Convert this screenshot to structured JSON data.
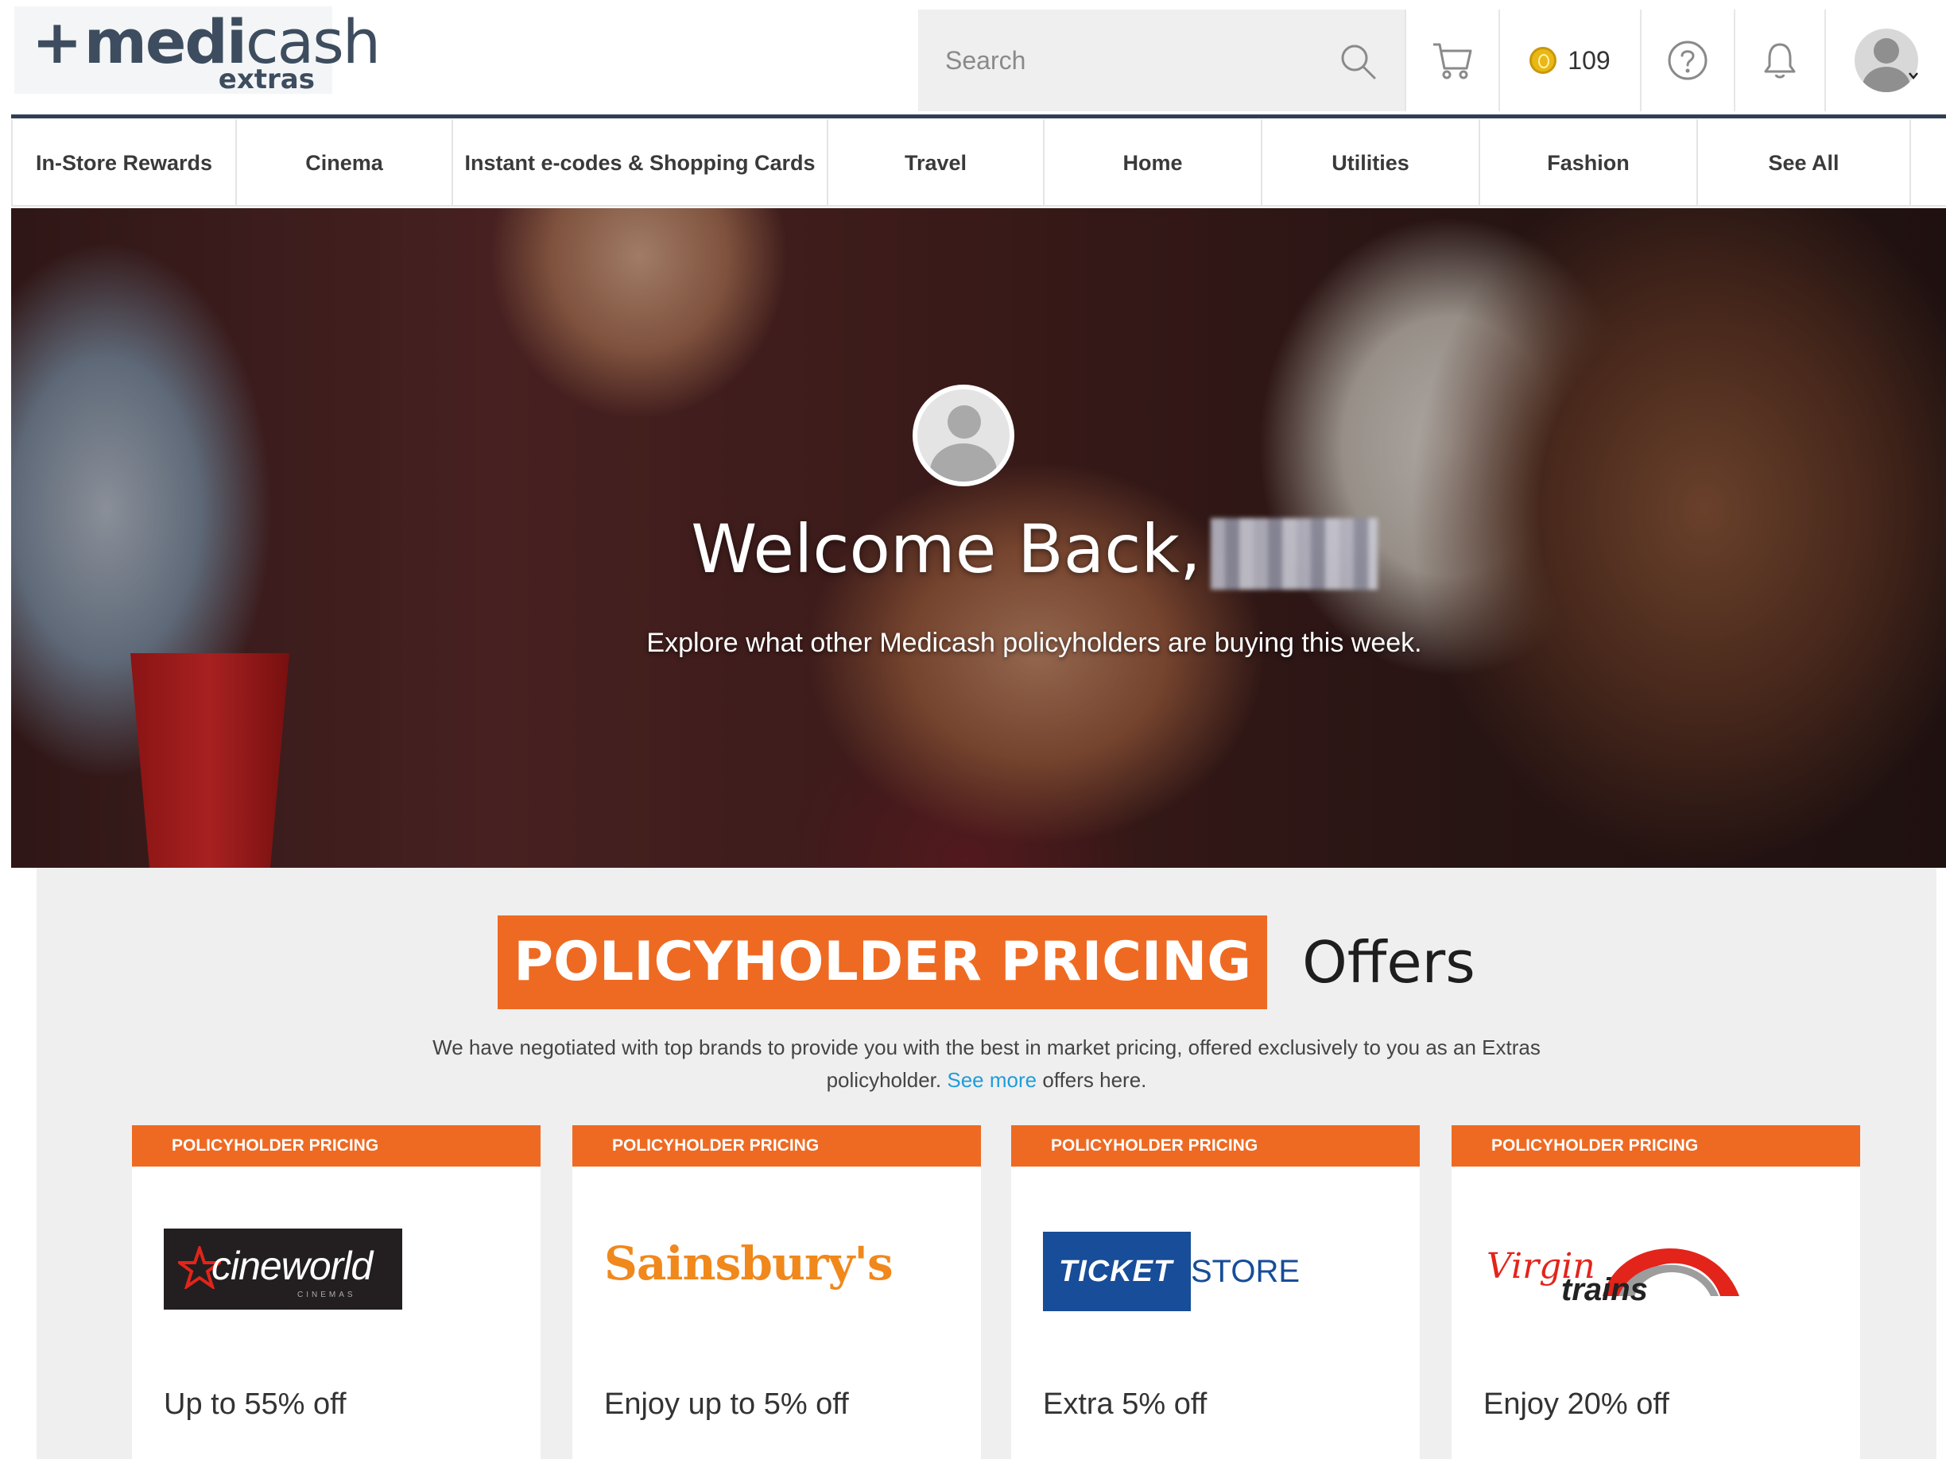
{
  "logo": {
    "main_prefix": "+",
    "main_medi": "medi",
    "main_cash": "cash",
    "sub": "extras"
  },
  "search": {
    "placeholder": "Search"
  },
  "header": {
    "coins": "109"
  },
  "nav": {
    "items": [
      "In-Store Rewards",
      "Cinema",
      "Instant e-codes & Shopping Cards",
      "Travel",
      "Home",
      "Utilities",
      "Fashion",
      "See All"
    ]
  },
  "hero": {
    "greeting": "Welcome Back,",
    "subtitle": "Explore what other Medicash policyholders are buying this week."
  },
  "offers": {
    "badge": "POLICYHOLDER PRICING",
    "title_word": "Offers",
    "desc_part1": "We have negotiated with top brands to provide you with the best in market pricing, offered exclusively to you as an Extras",
    "desc_part2": "policyholder.",
    "see_more": "See more",
    "desc_part3": "offers here.",
    "cards": [
      {
        "tag": "POLICYHOLDER PRICING",
        "brand": "cineworld",
        "brand_small": "CINEMAS",
        "offer": "Up to 55% off"
      },
      {
        "tag": "POLICYHOLDER PRICING",
        "brand": "Sainsbury's",
        "offer": "Enjoy up to 5% off"
      },
      {
        "tag": "POLICYHOLDER PRICING",
        "brand_a": "TICKET",
        "brand_b": "STORE",
        "offer": "Extra 5% off"
      },
      {
        "tag": "POLICYHOLDER PRICING",
        "brand_a": "Virgin",
        "brand_b": "trains",
        "offer": "Enjoy 20% off"
      }
    ]
  },
  "colors": {
    "accent_orange": "#ee6a22",
    "navy": "#2f3f52",
    "link_blue": "#1f9dd9",
    "coin_gold": "#e9b814"
  }
}
